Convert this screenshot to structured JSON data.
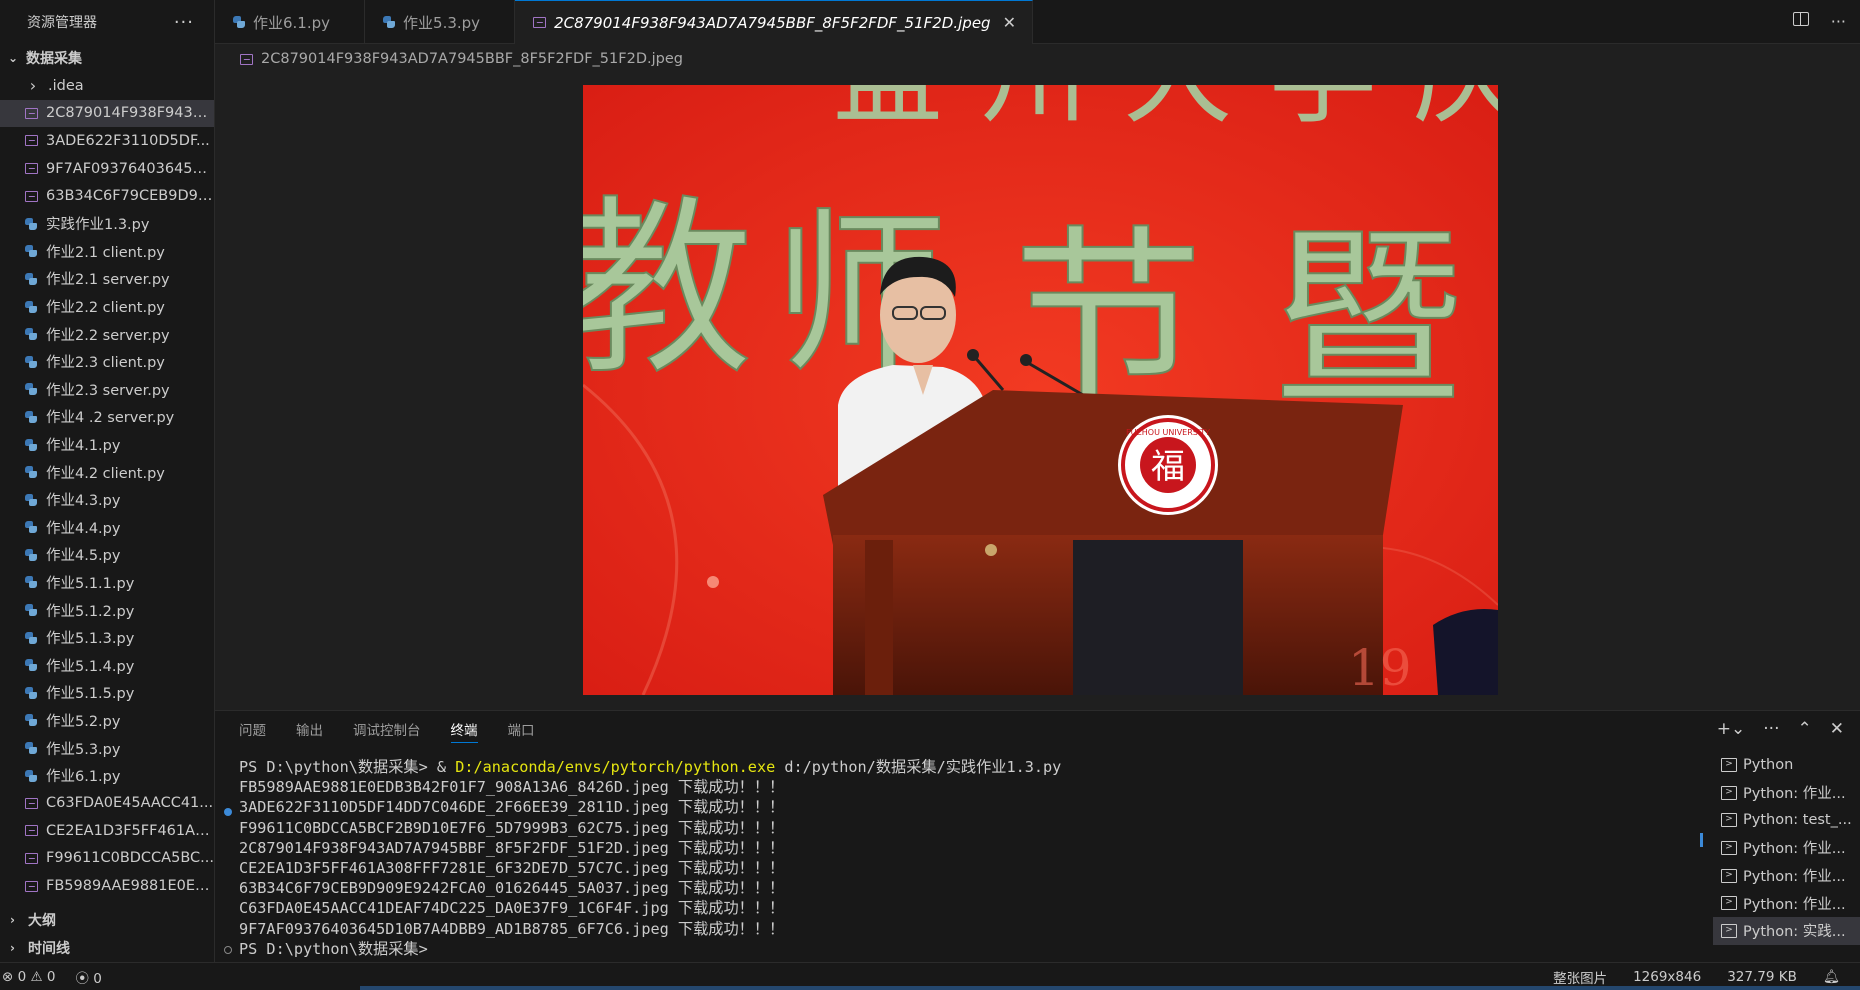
{
  "explorer": {
    "title": "资源管理器",
    "more": "···",
    "root_folder": "数据采集",
    "items": [
      {
        "label": ".idea",
        "kind": "folder"
      },
      {
        "label": "2C879014F938F943A...",
        "kind": "image",
        "selected": true
      },
      {
        "label": "3ADE622F3110D5DF...",
        "kind": "image"
      },
      {
        "label": "9F7AF09376403645D...",
        "kind": "image"
      },
      {
        "label": "63B34C6F79CEB9D90...",
        "kind": "image"
      },
      {
        "label": "实践作业1.3.py",
        "kind": "python"
      },
      {
        "label": "作业2.1 client.py",
        "kind": "python"
      },
      {
        "label": "作业2.1 server.py",
        "kind": "python"
      },
      {
        "label": "作业2.2 client.py",
        "kind": "python"
      },
      {
        "label": "作业2.2 server.py",
        "kind": "python"
      },
      {
        "label": "作业2.3 client.py",
        "kind": "python"
      },
      {
        "label": "作业2.3 server.py",
        "kind": "python"
      },
      {
        "label": "作业4 .2 server.py",
        "kind": "python"
      },
      {
        "label": "作业4.1.py",
        "kind": "python"
      },
      {
        "label": "作业4.2 client.py",
        "kind": "python"
      },
      {
        "label": "作业4.3.py",
        "kind": "python"
      },
      {
        "label": "作业4.4.py",
        "kind": "python"
      },
      {
        "label": "作业4.5.py",
        "kind": "python"
      },
      {
        "label": "作业5.1.1.py",
        "kind": "python"
      },
      {
        "label": "作业5.1.2.py",
        "kind": "python"
      },
      {
        "label": "作业5.1.3.py",
        "kind": "python"
      },
      {
        "label": "作业5.1.4.py",
        "kind": "python"
      },
      {
        "label": "作业5.1.5.py",
        "kind": "python"
      },
      {
        "label": "作业5.2.py",
        "kind": "python"
      },
      {
        "label": "作业5.3.py",
        "kind": "python"
      },
      {
        "label": "作业6.1.py",
        "kind": "python"
      },
      {
        "label": "C63FDA0E45AACC41...",
        "kind": "image"
      },
      {
        "label": "CE2EA1D3F5FF461A3...",
        "kind": "image"
      },
      {
        "label": "F99611C0BDCCA5BC...",
        "kind": "image"
      },
      {
        "label": "FB5989AAE9881E0ED...",
        "kind": "image"
      }
    ],
    "outline": "大纲",
    "timeline": "时间线"
  },
  "tabs": [
    {
      "label": "作业6.1.py",
      "kind": "python"
    },
    {
      "label": "作业5.3.py",
      "kind": "python"
    },
    {
      "label": "2C879014F938F943AD7A7945BBF_8F5F2FDF_51F2D.jpeg",
      "kind": "image",
      "active": true
    }
  ],
  "breadcrumb": "2C879014F938F943AD7A7945BBF_8F5F2FDF_51F2D.jpeg",
  "panel": {
    "tabs": [
      "问题",
      "输出",
      "调试控制台",
      "终端",
      "端口"
    ],
    "active_tab": "终端",
    "terminal": {
      "prompt_line": {
        "prefix": "PS D:\\python\\数据采集> & ",
        "exe": "D:/anaconda/envs/pytorch/python.exe",
        "args": " d:/python/数据采集/实践作业1.3.py"
      },
      "output": [
        "FB5989AAE9881E0EDB3B42F01F7_908A13A6_8426D.jpeg 下载成功！！！",
        "3ADE622F3110D5DF14DD7C046DE_2F66EE39_2811D.jpeg 下载成功！！！",
        "F99611C0BDCCA5BCF2B9D10E7F6_5D7999B3_62C75.jpeg 下载成功！！！",
        "2C879014F938F943AD7A7945BBF_8F5F2FDF_51F2D.jpeg 下载成功！！！",
        "CE2EA1D3F5FF461A308FFF7281E_6F32DE7D_57C7C.jpeg 下载成功！！！",
        "63B34C6F79CEB9D909E9242FCA0_01626445_5A037.jpeg 下载成功！！！",
        "C63FDA0E45AACC41DEAF74DC225_DA0E37F9_1C6F4F.jpg 下载成功！！！",
        "9F7AF09376403645D10B7A4DBB9_AD1B8785_6F7C6.jpeg 下载成功！！！"
      ],
      "last_prompt": "PS D:\\python\\数据采集>"
    },
    "terminal_list": [
      {
        "label": "Python"
      },
      {
        "label": "Python: 作业..."
      },
      {
        "label": "Python: test_..."
      },
      {
        "label": "Python: 作业..."
      },
      {
        "label": "Python: 作业..."
      },
      {
        "label": "Python: 作业..."
      },
      {
        "label": "Python: 实践...",
        "selected": true
      }
    ]
  },
  "image_view": {
    "banner_chars": [
      "教",
      "师",
      "节",
      "暨"
    ],
    "seal_text": "FUZHOU UNIVERSITY",
    "seal_char": "福"
  },
  "statusbar": {
    "errors": "0",
    "warnings": "0",
    "ports": "0",
    "mode": "整张图片",
    "dimensions": "1269x846",
    "size": "327.79 KB"
  },
  "colors": {
    "accent": "#0078d4",
    "background": "#1f1f1f",
    "sidebar": "#181818",
    "banner_red": "#e8271a",
    "banner_text": "#a8c79a"
  }
}
